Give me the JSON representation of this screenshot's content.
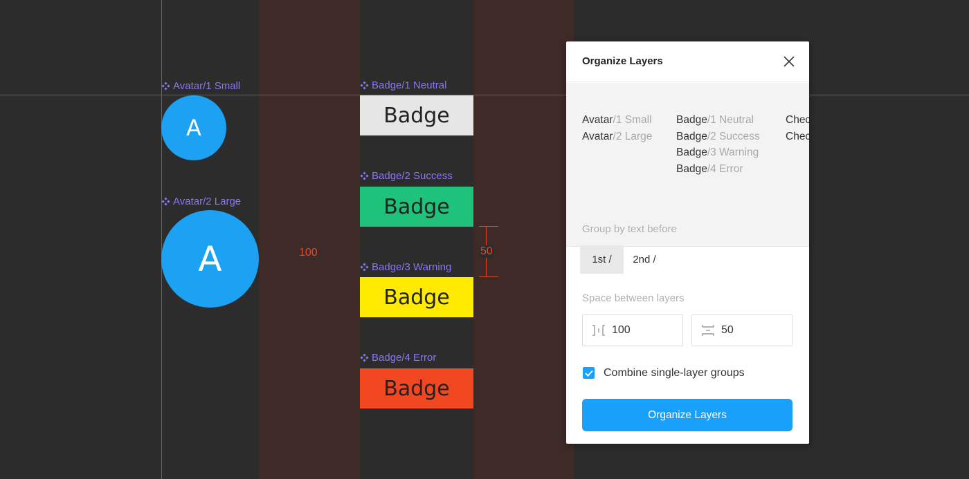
{
  "canvas": {
    "dimension_horizontal": "100",
    "dimension_vertical": "50",
    "components": [
      {
        "label": "Avatar/1 Small",
        "letter": "A",
        "color": "#1da1f2"
      },
      {
        "label": "Avatar/2 Large",
        "letter": "A",
        "color": "#1da1f2"
      },
      {
        "label": "Badge/1 Neutral",
        "text": "Badge",
        "color": "#e6e6e6"
      },
      {
        "label": "Badge/2 Success",
        "text": "Badge",
        "color": "#1ec27a"
      },
      {
        "label": "Badge/3 Warning",
        "text": "Badge",
        "color": "#ffeb00"
      },
      {
        "label": "Badge/4 Error",
        "text": "Badge",
        "color": "#f24822"
      }
    ]
  },
  "panel": {
    "title": "Organize Layers",
    "close_icon": "close-icon",
    "preview": {
      "columns": [
        [
          {
            "prefix": "Avatar",
            "suffix": "/1 Small"
          },
          {
            "prefix": "Avatar",
            "suffix": "/2 Large"
          }
        ],
        [
          {
            "prefix": "Badge",
            "suffix": "/1 Neutral"
          },
          {
            "prefix": "Badge",
            "suffix": "/2 Success"
          },
          {
            "prefix": "Badge",
            "suffix": "/3 Warning"
          },
          {
            "prefix": "Badge",
            "suffix": "/4 Error"
          }
        ],
        [
          {
            "prefix": "Chec",
            "suffix": ""
          },
          {
            "prefix": "Chec",
            "suffix": ""
          }
        ]
      ]
    },
    "group_label": "Group by text before",
    "group_options": [
      "1st /",
      "2nd /"
    ],
    "group_selected": "1st /",
    "spacing_label": "Space between layers",
    "horizontal_spacing": "100",
    "vertical_spacing": "50",
    "combine_label": "Combine single-layer groups",
    "combine_checked": true,
    "submit_label": "Organize Layers",
    "accent": "#18a0fb"
  }
}
